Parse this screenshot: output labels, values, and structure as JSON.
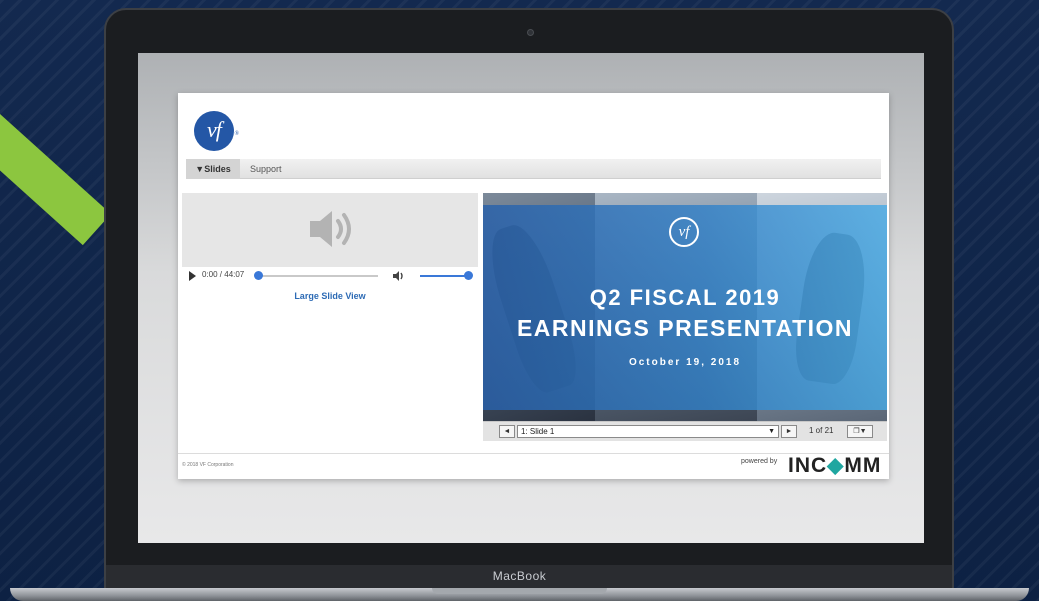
{
  "device": {
    "label": "MacBook"
  },
  "webpage": {
    "logo_text": "vf",
    "logo_mark": "®",
    "tabs": [
      {
        "label": "▼Slides",
        "active": true
      },
      {
        "label": "Support",
        "active": false
      }
    ],
    "player": {
      "time": "0:00 / 44:07",
      "progress_fraction": 0.0,
      "volume_fraction": 1.0,
      "icons": [
        "speaker-large-icon",
        "play-icon",
        "volume-icon"
      ]
    },
    "large_slide_view_label": "Large Slide View",
    "slide": {
      "logo_text": "vf",
      "title_line1": "Q2 FISCAL 2019",
      "title_line2": "EARNINGS PRESENTATION",
      "date": "October 19, 2018"
    },
    "slide_nav": {
      "prev_label": "◄",
      "selected_slide": "1: Slide 1",
      "select_arrow": "▼",
      "next_label": "►",
      "count": "1 of 21",
      "menu_label": "❐▼"
    },
    "footer": {
      "copyright": "© 2018 VF Corporation",
      "powered_by": "powered by",
      "brand_left": "IN",
      "brand_mid": "C",
      "brand_diamond": "◆",
      "brand_right": "MM"
    }
  },
  "colors": {
    "background_navy": "#0e2346",
    "accent_green": "#8cc63f",
    "vf_blue": "#2457a6",
    "player_blue": "#3a78d8",
    "link_blue": "#2d6bb5",
    "incomm_teal": "#1fa6a0"
  }
}
